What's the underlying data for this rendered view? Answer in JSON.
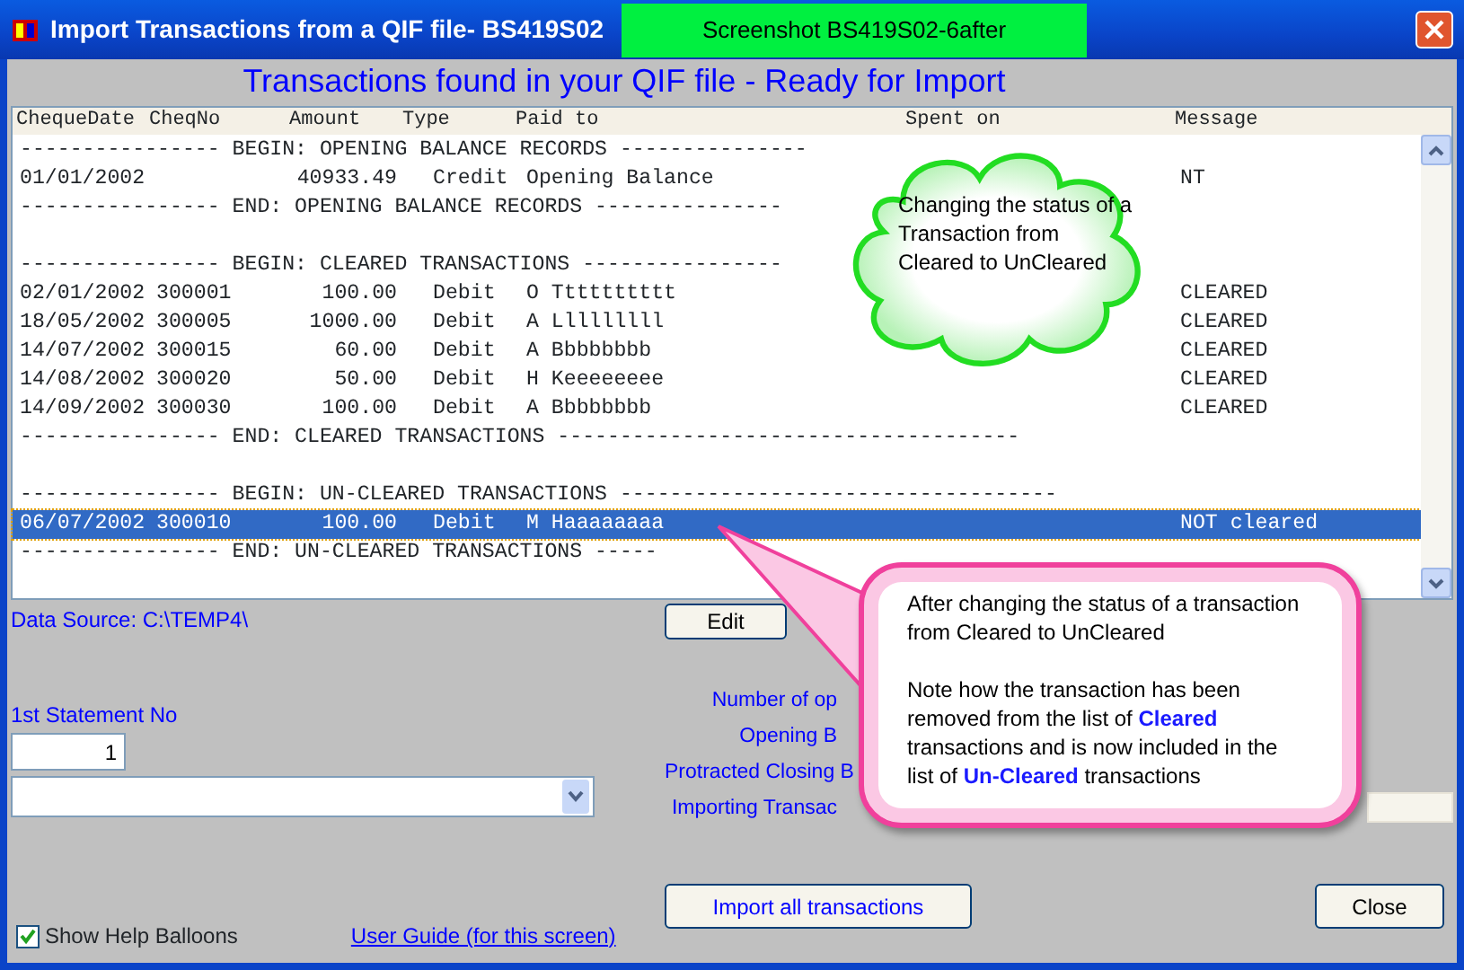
{
  "window": {
    "title": "Import Transactions from a QIF file- BS419S02",
    "badge": "Screenshot BS419S02-6after"
  },
  "heading": "Transactions found in your QIF file - Ready for Import",
  "columns": [
    "ChequeDate",
    "CheqNo",
    "Amount",
    "Type",
    "Paid to",
    "Spent on",
    "Message"
  ],
  "rows": [
    {
      "kind": "separator",
      "text": "---------------- BEGIN: OPENING BALANCE RECORDS ---------------"
    },
    {
      "kind": "transaction",
      "date": "01/01/2002",
      "cheq_no": "",
      "amount": "40933.49",
      "type": "Credit",
      "paid_to": "Opening Balance",
      "message": "NT",
      "selected": false
    },
    {
      "kind": "separator",
      "text": "---------------- END: OPENING BALANCE RECORDS ---------------"
    },
    {
      "kind": "blank"
    },
    {
      "kind": "separator",
      "text": "---------------- BEGIN: CLEARED TRANSACTIONS ----------------"
    },
    {
      "kind": "transaction",
      "date": "02/01/2002",
      "cheq_no": "300001",
      "amount": "100.00",
      "type": "Debit",
      "paid_to": "O Tttttttttt",
      "message": "CLEARED",
      "selected": false
    },
    {
      "kind": "transaction",
      "date": "18/05/2002",
      "cheq_no": "300005",
      "amount": "1000.00",
      "type": "Debit",
      "paid_to": "A Lllllllll",
      "message": "CLEARED",
      "selected": false
    },
    {
      "kind": "transaction",
      "date": "14/07/2002",
      "cheq_no": "300015",
      "amount": "60.00",
      "type": "Debit",
      "paid_to": "A Bbbbbbbb",
      "message": "CLEARED",
      "selected": false
    },
    {
      "kind": "transaction",
      "date": "14/08/2002",
      "cheq_no": "300020",
      "amount": "50.00",
      "type": "Debit",
      "paid_to": "H Keeeeeeee",
      "message": "CLEARED",
      "selected": false
    },
    {
      "kind": "transaction",
      "date": "14/09/2002",
      "cheq_no": "300030",
      "amount": "100.00",
      "type": "Debit",
      "paid_to": "A Bbbbbbbb",
      "message": "CLEARED",
      "selected": false
    },
    {
      "kind": "separator",
      "text": "---------------- END: CLEARED TRANSACTIONS -------------------------------------"
    },
    {
      "kind": "blank"
    },
    {
      "kind": "separator",
      "text": "---------------- BEGIN: UN-CLEARED TRANSACTIONS -----------------------------------"
    },
    {
      "kind": "transaction",
      "date": "06/07/2002",
      "cheq_no": "300010",
      "amount": "100.00",
      "type": "Debit",
      "paid_to": "M Haaaaaaaa",
      "message": "NOT cleared",
      "selected": true
    },
    {
      "kind": "separator",
      "text": "---------------- END: UN-CLEARED TRANSACTIONS -----"
    }
  ],
  "data_source": "Data Source: C:\\TEMP4\\",
  "edit_button": "Edit",
  "statement": {
    "label": "1st Statement No",
    "value": "1"
  },
  "summary_labels": [
    "Number of op",
    "Opening B",
    "Protracted Closing B",
    "Importing Transac"
  ],
  "import_button": "Import all transactions",
  "close_button": "Close",
  "show_help_balloons": {
    "label": "Show Help Balloons",
    "checked": true
  },
  "user_guide_link": "User Guide (for this screen)",
  "cloud_callout": "Changing the status of a Transaction from Cleared to UnCleared",
  "balloon_callout": [
    "After changing the status of a transaction from Cleared to UnCleared",
    "Note how the transaction has been removed from the list of **Cleared** transactions and is now included in the list of **Un-Cleared** transactions"
  ]
}
